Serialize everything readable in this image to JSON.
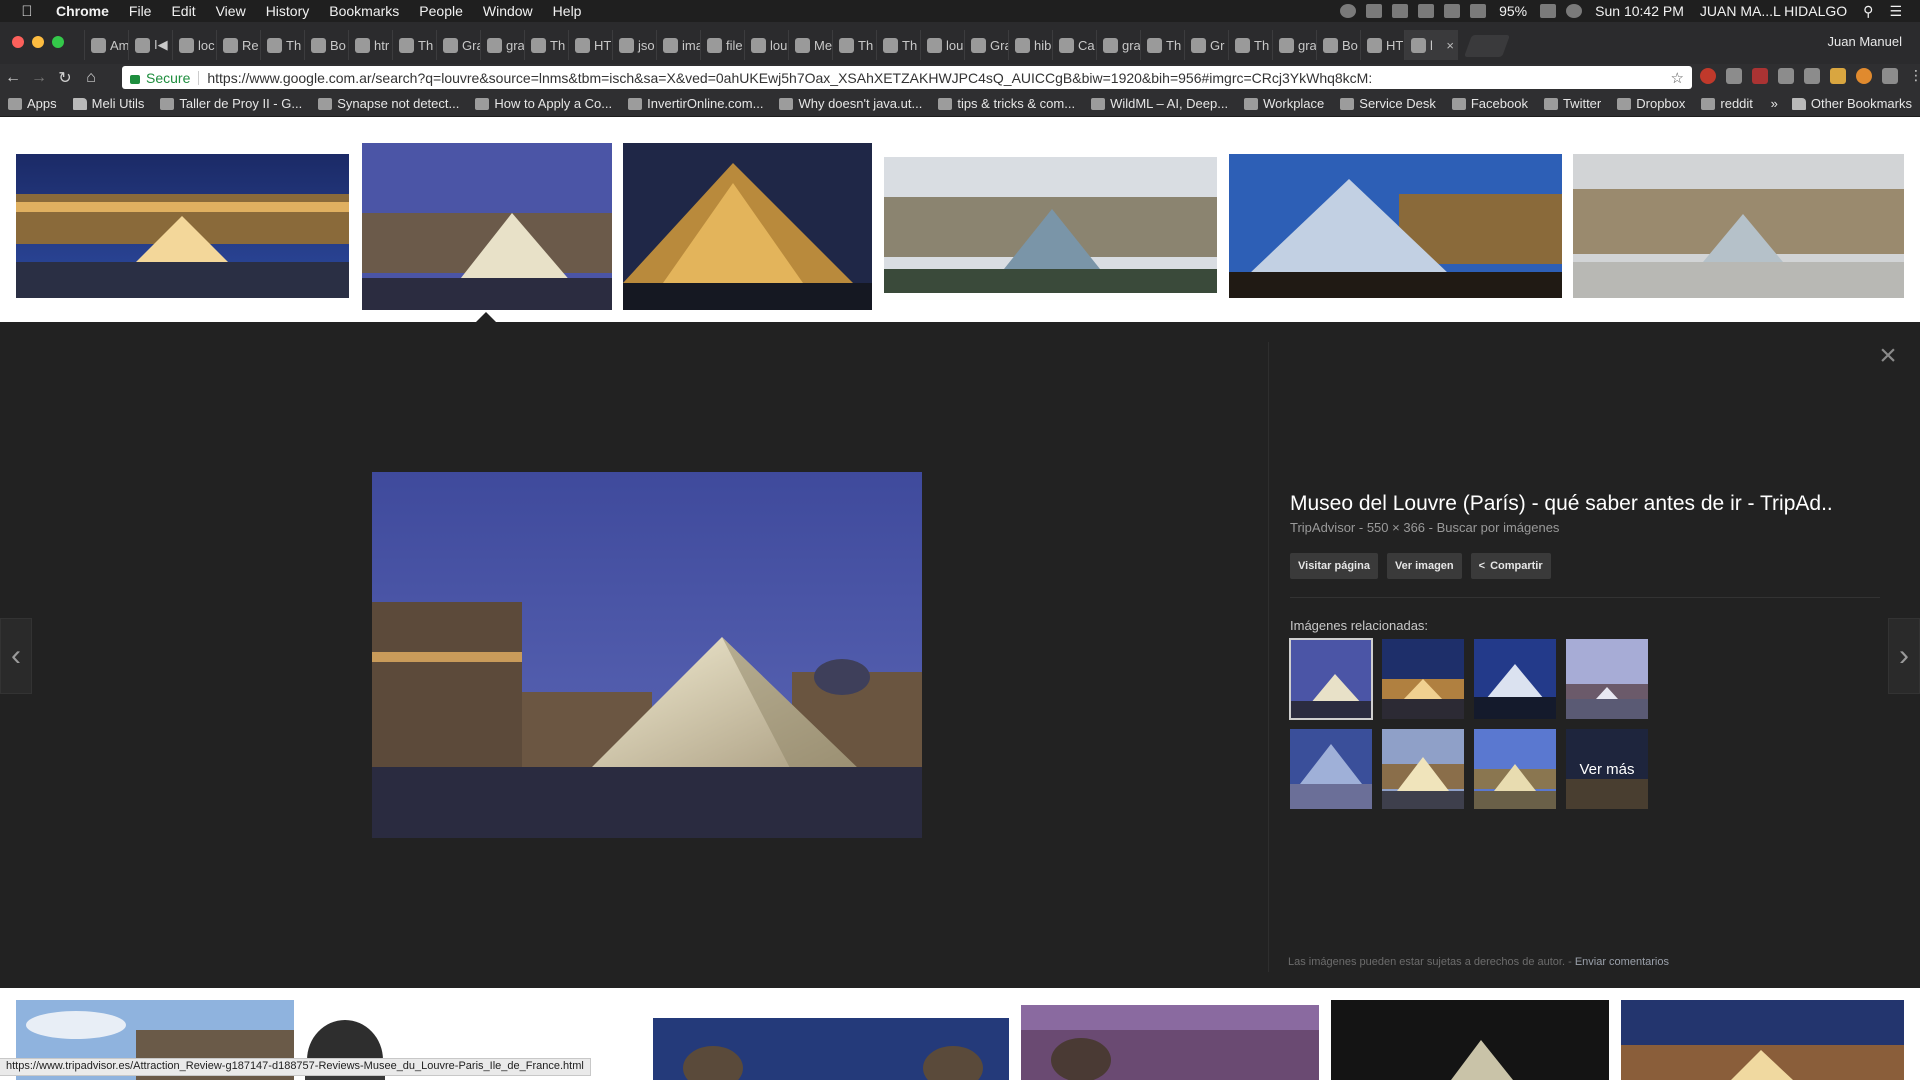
{
  "menubar": {
    "app_name": "Chrome",
    "menus": [
      "File",
      "Edit",
      "View",
      "History",
      "Bookmarks",
      "People",
      "Window",
      "Help"
    ],
    "battery": "95%",
    "clock": "Sun 10:42 PM",
    "user": "JUAN MA...L HIDALGO"
  },
  "tabstrip": {
    "tabs": [
      {
        "label": "Am",
        "icon": "amazon-icon"
      },
      {
        "label": "I◀",
        "icon": "youtube-icon"
      },
      {
        "label": "loc",
        "icon": "grammarly-icon"
      },
      {
        "label": "Re",
        "icon": "gmail-icon"
      },
      {
        "label": "Th",
        "icon": "page-icon"
      },
      {
        "label": "Bo",
        "icon": "sheets-icon"
      },
      {
        "label": "htr",
        "icon": "stackoverflow-icon"
      },
      {
        "label": "Th",
        "icon": "page-icon"
      },
      {
        "label": "Gra",
        "icon": "notion-icon"
      },
      {
        "label": "gra",
        "icon": "stackoverflow-icon"
      },
      {
        "label": "Th",
        "icon": "page-icon"
      },
      {
        "label": "HT",
        "icon": "sheets-icon"
      },
      {
        "label": "jso",
        "icon": "google-icon"
      },
      {
        "label": "ima",
        "icon": "stackoverflow-icon"
      },
      {
        "label": "file",
        "icon": "google-icon"
      },
      {
        "label": "lou",
        "icon": "page-icon"
      },
      {
        "label": "Me",
        "icon": "mail-icon"
      },
      {
        "label": "Th",
        "icon": "page-icon"
      },
      {
        "label": "Th",
        "icon": "page-icon"
      },
      {
        "label": "lou",
        "icon": "google-icon"
      },
      {
        "label": "Gra",
        "icon": "stackoverflow-icon"
      },
      {
        "label": "hib",
        "icon": "stackoverflow-icon"
      },
      {
        "label": "Ca",
        "icon": "sheets-icon"
      },
      {
        "label": "gra",
        "icon": "stackoverflow-icon"
      },
      {
        "label": "Th",
        "icon": "page-icon"
      },
      {
        "label": "Gr",
        "icon": "gc-icon"
      },
      {
        "label": "Th",
        "icon": "page-icon"
      },
      {
        "label": "gra",
        "icon": "stackoverflow-icon"
      },
      {
        "label": "Bo",
        "icon": "sheets-icon"
      },
      {
        "label": "HT",
        "icon": "sheets-icon"
      },
      {
        "label": "l",
        "icon": "google-icon"
      }
    ],
    "profile": "Juan Manuel"
  },
  "toolbar": {
    "secure_label": "Secure",
    "url": "https://www.google.com.ar/search?q=louvre&source=lnms&tbm=isch&sa=X&ved=0ahUKEwj5h7Oax_XSAhXETZAKHWJPC4sQ_AUICCgB&biw=1920&bih=956#imgrc=CRcj3YkWhq8kcM:"
  },
  "bookmarks": [
    {
      "label": "Apps",
      "icon": "apps-grid-icon"
    },
    {
      "label": "Meli Utils",
      "icon": "folder-icon"
    },
    {
      "label": "Taller de Proy II - G...",
      "icon": "drive-icon"
    },
    {
      "label": "Synapse not detect...",
      "icon": "page-icon"
    },
    {
      "label": "How to Apply a Co...",
      "icon": "gc-icon"
    },
    {
      "label": "InvertirOnline.com...",
      "icon": "iol-icon"
    },
    {
      "label": "Why doesn't java.ut...",
      "icon": "stackoverflow-icon"
    },
    {
      "label": "tips & tricks & com...",
      "icon": "youtube-icon"
    },
    {
      "label": "WildML – AI, Deep...",
      "icon": "page-icon"
    },
    {
      "label": "Workplace",
      "icon": "workplace-icon"
    },
    {
      "label": "Service Desk",
      "icon": "gear-icon"
    },
    {
      "label": "Facebook",
      "icon": "facebook-icon"
    },
    {
      "label": "Twitter",
      "icon": "twitter-icon"
    },
    {
      "label": "Dropbox",
      "icon": "dropbox-icon"
    },
    {
      "label": "reddit",
      "icon": "reddit-icon"
    }
  ],
  "bookmarks_more": "»",
  "bookmarks_other": "Other Bookmarks",
  "preview": {
    "title": "Museo del Louvre (París) - qué saber antes de ir - TripAd..",
    "source": "TripAdvisor",
    "dimensions": "550 × 366",
    "search_by_image": "Buscar por imágenes",
    "meta_sep": " - ",
    "visit_label": "Visitar página",
    "view_label": "Ver imagen",
    "share_label": "Compartir",
    "related_label": "Imágenes relacionadas:",
    "more_label": "Ver más",
    "footnote": "Las imágenes pueden estar sujetas a derechos de autor.",
    "footnote_sep": " - ",
    "feedback": "Enviar comentarios"
  },
  "status_url": "https://www.tripadvisor.es/Attraction_Review-g187147-d188757-Reviews-Musee_du_Louvre-Paris_Ile_de_France.html",
  "colors": {
    "panel_bg": "#222222",
    "omnibox_secure": "#1e8e3e"
  }
}
